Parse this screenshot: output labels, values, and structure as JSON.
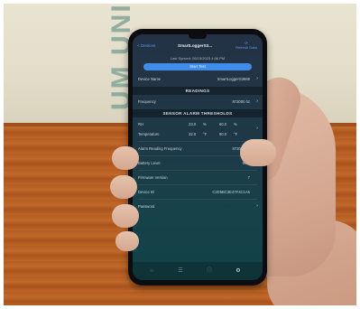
{
  "scene": {
    "wall_text": "UM UNI"
  },
  "app": {
    "nav": {
      "back_label": "< Devices",
      "title": "SmartLoggerS3...",
      "refresh_label": "Refresh Data"
    },
    "last_synced": "Last Synced: 06/15/2023 4:06 PM",
    "start_button": "Start Test",
    "device_name": {
      "label": "Device Name",
      "value": "SmartLoggerS3668"
    },
    "readings_header": "READINGS",
    "frequency": {
      "label": "Frequency",
      "value": "872000 hz"
    },
    "thresholds_header": "SENSOR ALARM THRESHOLDS",
    "rh": {
      "label": "RH",
      "low": "23.0",
      "low_unit": "%",
      "high": "60.0",
      "high_unit": "%"
    },
    "temperature": {
      "label": "Temperature",
      "low": "32.0",
      "low_unit": "°F",
      "high": "90.0",
      "high_unit": "°F"
    },
    "alarm_frequency": {
      "label": "Alarm Reading Frequency",
      "value": "872000 hz"
    },
    "battery": {
      "label": "Battery Level",
      "value": "99%"
    },
    "firmware": {
      "label": "Firmware Version",
      "value": "7"
    },
    "device_id": {
      "label": "Device ID",
      "value": "C2D5BC3E47F4C1A5"
    },
    "password": {
      "label": "Password"
    },
    "tabs": [
      {
        "icon": "home-icon",
        "active": false
      },
      {
        "icon": "list-icon",
        "active": false
      },
      {
        "icon": "info-icon",
        "active": false
      },
      {
        "icon": "settings-icon",
        "active": true
      }
    ]
  },
  "colors": {
    "accent": "#3f8de8",
    "screen_top": "#243245",
    "screen_bottom": "#114047"
  }
}
